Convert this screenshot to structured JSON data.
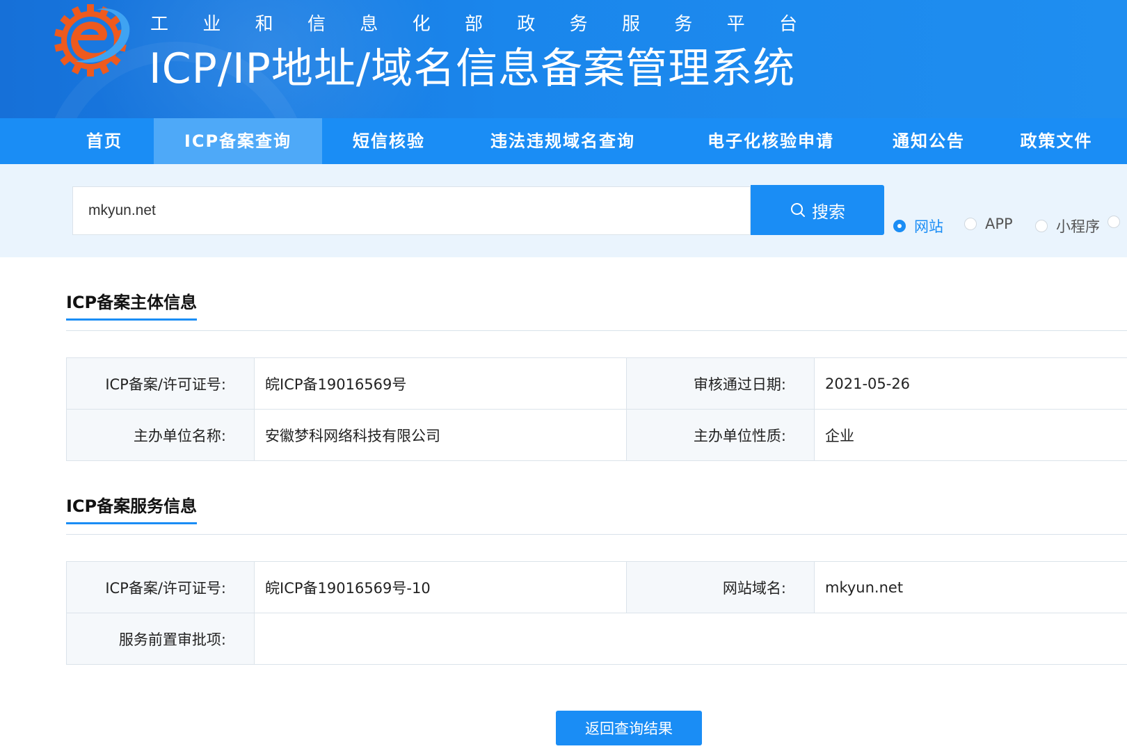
{
  "header": {
    "supertitle_chars": [
      "工",
      "业",
      "和",
      "信",
      "息",
      "化",
      "部",
      "政",
      "务",
      "服",
      "务",
      "平",
      "台"
    ],
    "title": "ICP/IP地址/域名信息备案管理系统",
    "logo_icon": "gear-e-logo-icon"
  },
  "nav": {
    "items": [
      {
        "label": "首页",
        "active": false
      },
      {
        "label": "ICP备案查询",
        "active": true
      },
      {
        "label": "短信核验",
        "active": false
      },
      {
        "label": "违法违规域名查询",
        "active": false
      },
      {
        "label": "电子化核验申请",
        "active": false
      },
      {
        "label": "通知公告",
        "active": false
      },
      {
        "label": "政策文件",
        "active": false
      }
    ]
  },
  "search": {
    "value": "mkyun.net",
    "button_label": "搜索",
    "button_icon": "search-icon",
    "types": [
      {
        "label": "网站",
        "checked": true
      },
      {
        "label": "APP",
        "checked": false
      },
      {
        "label": "小程序",
        "checked": false
      },
      {
        "label": "",
        "checked": false
      }
    ]
  },
  "subject_info": {
    "title": "ICP备案主体信息",
    "rows": [
      {
        "label1": "ICP备案/许可证号:",
        "value1": "皖ICP备19016569号",
        "label2": "审核通过日期:",
        "value2": "2021-05-26"
      },
      {
        "label1": "主办单位名称:",
        "value1": "安徽梦科网络科技有限公司",
        "label2": "主办单位性质:",
        "value2": "企业"
      }
    ]
  },
  "service_info": {
    "title": "ICP备案服务信息",
    "row1": {
      "label1": "ICP备案/许可证号:",
      "value1": "皖ICP备19016569号-10",
      "label2": "网站域名:",
      "value2": "mkyun.net"
    },
    "row2": {
      "label": "服务前置审批项:",
      "value": ""
    }
  },
  "back_button": "返回查询结果",
  "colors": {
    "primary": "#1a8df5",
    "nav_active": "#4ea9f8",
    "band": "#eaf4fd",
    "logo_orange": "#ee5a1e"
  }
}
